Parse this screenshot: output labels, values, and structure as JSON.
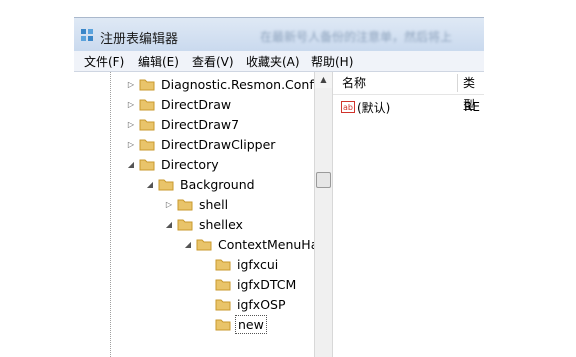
{
  "window": {
    "title": "注册表编辑器",
    "blurred_text": "在最新号人备份的注意单，然后将上"
  },
  "menu": [
    "文件(F)",
    "编辑(E)",
    "查看(V)",
    "收藏夹(A)",
    "帮助(H)"
  ],
  "tree": [
    {
      "label": "Diagnostic.Resmon.Config",
      "expander": "▷",
      "selected": false
    },
    {
      "label": "DirectDraw",
      "expander": "▷",
      "selected": false
    },
    {
      "label": "DirectDraw7",
      "expander": "▷",
      "selected": false
    },
    {
      "label": "DirectDrawClipper",
      "expander": "▷",
      "selected": false
    },
    {
      "label": "Directory",
      "expander": "◢",
      "selected": false
    },
    {
      "label": "Background",
      "expander": "◢",
      "selected": false
    },
    {
      "label": "shell",
      "expander": "▷",
      "selected": false
    },
    {
      "label": "shellex",
      "expander": "◢",
      "selected": false
    },
    {
      "label": "ContextMenuHa",
      "expander": "◢",
      "selected": false
    },
    {
      "label": "igfxcui",
      "expander": "",
      "selected": false
    },
    {
      "label": "igfxDTCM",
      "expander": "",
      "selected": false
    },
    {
      "label": "igfxOSP",
      "expander": "",
      "selected": false
    },
    {
      "label": "new",
      "expander": "",
      "selected": true
    }
  ],
  "list": {
    "columns": [
      "名称",
      "类型"
    ],
    "rows": [
      {
        "icon": "string-value-icon",
        "name": "(默认)",
        "type": "RE"
      }
    ]
  },
  "colors": {
    "folder": "#e9c46a",
    "folder_dark": "#c99a2e",
    "ab_icon": "#d0342c"
  }
}
